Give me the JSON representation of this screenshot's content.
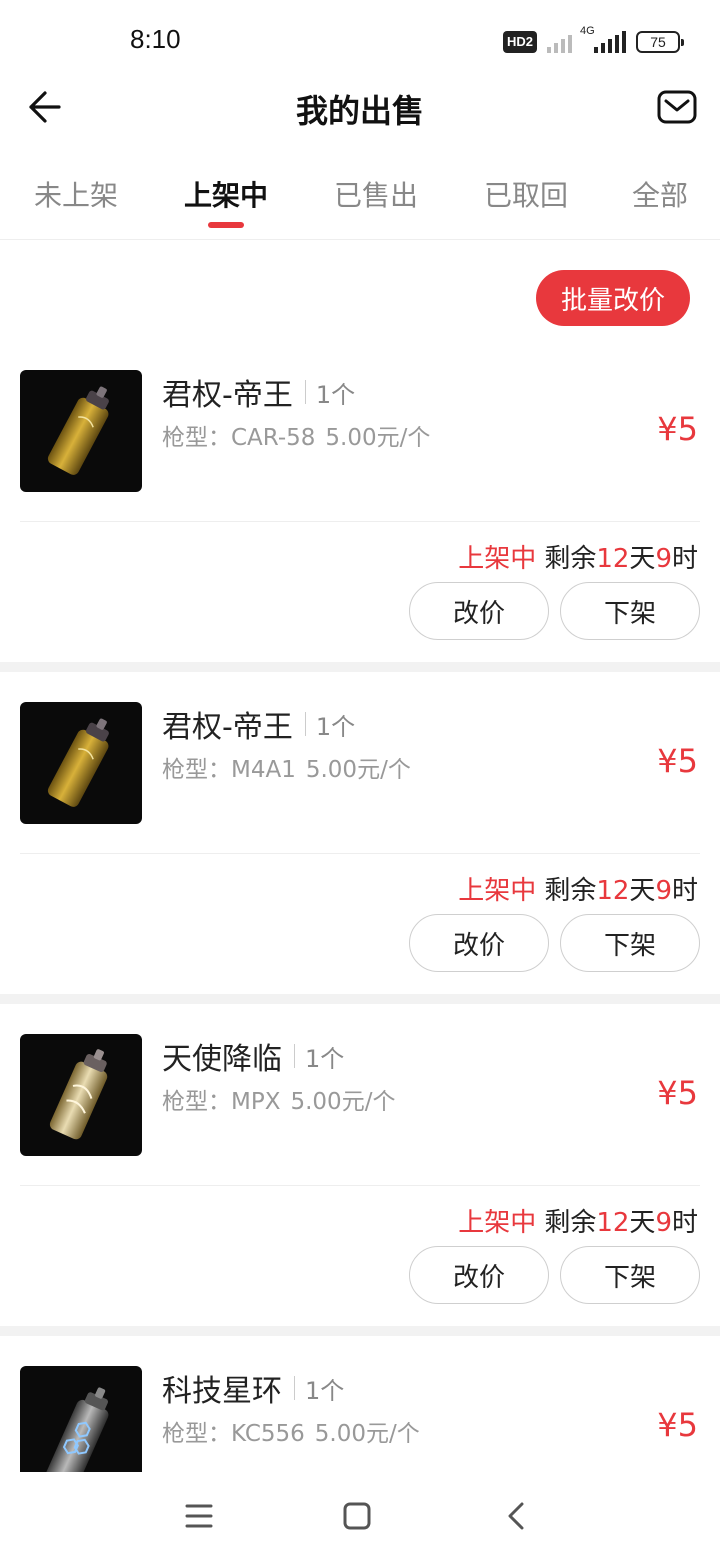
{
  "status_bar": {
    "time": "8:10",
    "hd_label": "HD2",
    "network_label": "4G",
    "battery": "75",
    "icons": [
      "signal-icon",
      "signal-4g-icon",
      "battery-icon"
    ]
  },
  "header": {
    "title": "我的出售",
    "back_icon": "arrow-left-icon",
    "mail_icon": "mail-icon"
  },
  "tabs": [
    {
      "label": "未上架",
      "active": false
    },
    {
      "label": "上架中",
      "active": true
    },
    {
      "label": "已售出",
      "active": false
    },
    {
      "label": "已取回",
      "active": false
    },
    {
      "label": "全部",
      "active": false
    }
  ],
  "batch_button": "批量改价",
  "items": [
    {
      "name": "君权-帝王",
      "qty": "1个",
      "gun_type": "枪型：CAR-58",
      "unit_price": "5.00元/个",
      "price": "¥5",
      "status": "上架中",
      "remain_prefix": "剩余",
      "days": "12",
      "day_unit": "天",
      "hours": "9",
      "hour_unit": "时",
      "reprice_label": "改价",
      "delist_label": "下架",
      "image": "spray-can-gold"
    },
    {
      "name": "君权-帝王",
      "qty": "1个",
      "gun_type": "枪型：M4A1",
      "unit_price": "5.00元/个",
      "price": "¥5",
      "status": "上架中",
      "remain_prefix": "剩余",
      "days": "12",
      "day_unit": "天",
      "hours": "9",
      "hour_unit": "时",
      "reprice_label": "改价",
      "delist_label": "下架",
      "image": "spray-can-gold"
    },
    {
      "name": "天使降临",
      "qty": "1个",
      "gun_type": "枪型：MPX",
      "unit_price": "5.00元/个",
      "price": "¥5",
      "status": "上架中",
      "remain_prefix": "剩余",
      "days": "12",
      "day_unit": "天",
      "hours": "9",
      "hour_unit": "时",
      "reprice_label": "改价",
      "delist_label": "下架",
      "image": "spray-can-angel"
    },
    {
      "name": "科技星环",
      "qty": "1个",
      "gun_type": "枪型：KC556",
      "unit_price": "5.00元/个",
      "price": "¥5",
      "image": "spray-can-hex"
    }
  ],
  "nav": {
    "icons": [
      "menu-icon",
      "home-square-icon",
      "back-chevron-icon"
    ]
  },
  "colors": {
    "accent": "#e8383d",
    "text": "#222222",
    "muted": "#999999",
    "divider": "#eeeeee",
    "gap": "#f2f2f2"
  }
}
